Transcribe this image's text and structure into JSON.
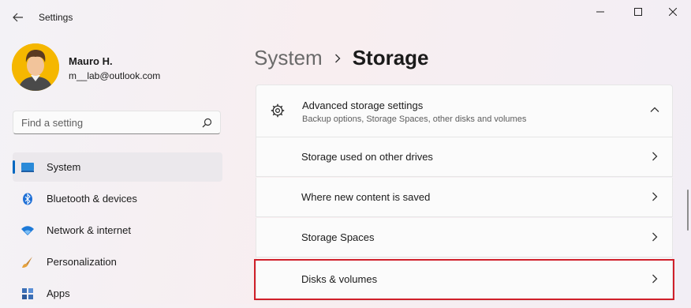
{
  "window": {
    "title": "Settings"
  },
  "user": {
    "name": "Mauro H.",
    "email": "m__lab@outlook.com"
  },
  "search": {
    "placeholder": "Find a setting"
  },
  "sidebar": {
    "items": [
      {
        "label": "System",
        "icon": "system-icon",
        "active": true
      },
      {
        "label": "Bluetooth & devices",
        "icon": "bluetooth-icon"
      },
      {
        "label": "Network & internet",
        "icon": "wifi-icon"
      },
      {
        "label": "Personalization",
        "icon": "brush-icon"
      },
      {
        "label": "Apps",
        "icon": "apps-icon"
      }
    ]
  },
  "breadcrumb": {
    "parent": "System",
    "current": "Storage"
  },
  "advanced": {
    "title": "Advanced storage settings",
    "subtitle": "Backup options, Storage Spaces, other disks and volumes",
    "rows": [
      {
        "label": "Storage used on other drives"
      },
      {
        "label": "Where new content is saved"
      },
      {
        "label": "Storage Spaces"
      },
      {
        "label": "Disks & volumes",
        "highlighted": true
      }
    ]
  },
  "colors": {
    "accent": "#0067c0",
    "highlight": "#d0202a",
    "avatar_bg": "#f5b700"
  }
}
